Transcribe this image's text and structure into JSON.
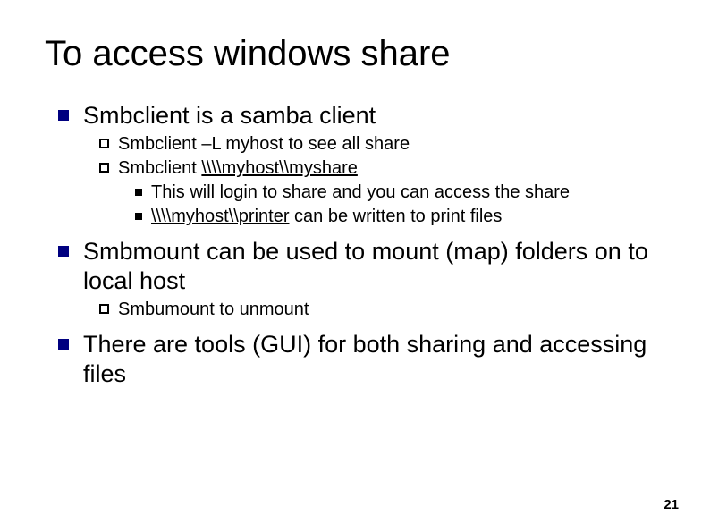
{
  "title": "To access windows share",
  "items": [
    {
      "text": "Smbclient is a samba client",
      "children": [
        {
          "text": "Smbclient –L myhost to see all share"
        },
        {
          "prefix": "Smbclient ",
          "underlined": "\\\\\\\\myhost\\\\myshare",
          "children": [
            {
              "text": "This will login to share and you can access the share"
            },
            {
              "underlined": "\\\\\\\\myhost\\\\printer",
              "suffix": " can be written to print files"
            }
          ]
        }
      ]
    },
    {
      "text": "Smbmount can be used to mount (map) folders on to local host",
      "children": [
        {
          "text": "Smbumount to unmount"
        }
      ]
    },
    {
      "text": "There are tools (GUI) for both sharing and accessing files"
    }
  ],
  "page_number": "21"
}
